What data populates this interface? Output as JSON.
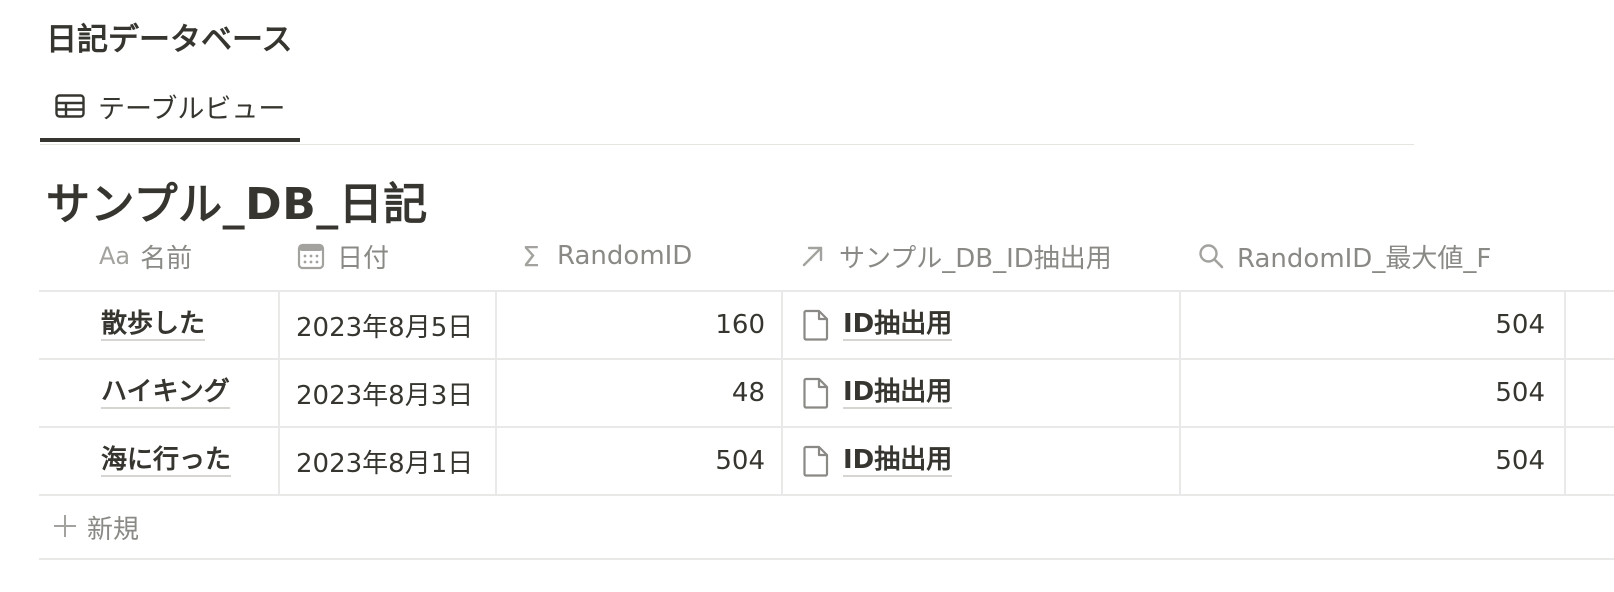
{
  "page": {
    "title": "日記データベース"
  },
  "view_tab": {
    "label": "テーブルビュー",
    "icon": "table-icon"
  },
  "database": {
    "title": "サンプル_DB_日記"
  },
  "columns": [
    {
      "label": "名前",
      "icon": "aa-text-icon",
      "icon_text": "Aa"
    },
    {
      "label": "日付",
      "icon": "calendar-icon"
    },
    {
      "label": "RandomID",
      "icon": "sigma-icon",
      "icon_text": "Σ"
    },
    {
      "label": "サンプル_DB_ID抽出用",
      "icon": "arrow-up-right-icon"
    },
    {
      "label": "RandomID_最大値_F",
      "icon": "search-icon"
    }
  ],
  "rows": [
    {
      "name": "散歩した",
      "date": "2023年8月5日",
      "random_id": "160",
      "relation": "ID抽出用",
      "max_value": "504"
    },
    {
      "name": "ハイキング",
      "date": "2023年8月3日",
      "random_id": "48",
      "relation": "ID抽出用",
      "max_value": "504"
    },
    {
      "name": "海に行った",
      "date": "2023年8月1日",
      "random_id": "504",
      "relation": "ID抽出用",
      "max_value": "504"
    }
  ],
  "new_row": {
    "label": "新規",
    "icon": "plus-icon"
  },
  "colors": {
    "text": "#37352f",
    "muted": "#8a8985",
    "border": "#e9e9e7"
  }
}
